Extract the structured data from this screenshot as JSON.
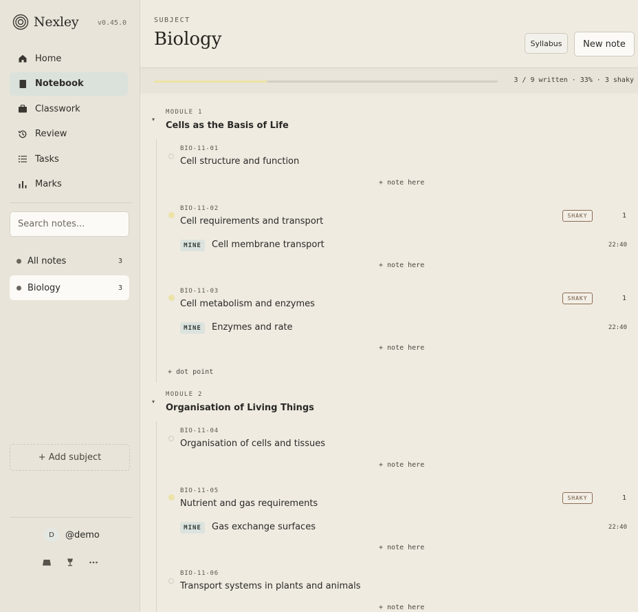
{
  "app": {
    "name": "Nexley",
    "version": "v0.45.0"
  },
  "nav": [
    {
      "label": "Home",
      "icon": "home-icon"
    },
    {
      "label": "Notebook",
      "icon": "notebook-icon",
      "active": true
    },
    {
      "label": "Classwork",
      "icon": "briefcase-icon"
    },
    {
      "label": "Review",
      "icon": "history-icon"
    },
    {
      "label": "Tasks",
      "icon": "list-icon"
    },
    {
      "label": "Marks",
      "icon": "bar-chart-icon"
    }
  ],
  "search": {
    "placeholder": "Search notes..."
  },
  "filters": [
    {
      "label": "All notes",
      "count": "3"
    },
    {
      "label": "Biology",
      "count": "3",
      "active": true
    }
  ],
  "add_subject_label": "+ Add subject",
  "user": {
    "initial": "D",
    "handle": "@demo"
  },
  "header": {
    "subject_label": "SUBJECT",
    "title": "Biology",
    "syllabus_label": "Syllabus",
    "new_note_label": "New note"
  },
  "progress": {
    "fraction": 0.33,
    "summary": "3 / 9 written · 33% · 3 shaky"
  },
  "shaky_label": "SHAKY",
  "mine_label": "MINE",
  "add_note_label": "+ note here",
  "add_dot_point_label": "+ dot point",
  "modules": [
    {
      "label": "MODULE 1",
      "title": "Cells as the Basis of Life",
      "dot_points": [
        {
          "code": "BIO-11-01",
          "title": "Cell structure and function"
        },
        {
          "code": "BIO-11-02",
          "title": "Cell requirements and transport",
          "count": "1",
          "note": {
            "title": "Cell membrane transport",
            "time": "22:40"
          }
        },
        {
          "code": "BIO-11-03",
          "title": "Cell metabolism and enzymes",
          "count": "1",
          "note": {
            "title": "Enzymes and rate",
            "time": "22:40"
          }
        }
      ]
    },
    {
      "label": "MODULE 2",
      "title": "Organisation of Living Things",
      "dot_points": [
        {
          "code": "BIO-11-04",
          "title": "Organisation of cells and tissues"
        },
        {
          "code": "BIO-11-05",
          "title": "Nutrient and gas requirements",
          "count": "1",
          "note": {
            "title": "Gas exchange surfaces",
            "time": "22:40"
          }
        },
        {
          "code": "BIO-11-06",
          "title": "Transport systems in plants and animals"
        }
      ]
    }
  ],
  "colors": {
    "accent_progress": "#ece3a6",
    "active_nav": "#dae2db",
    "shaky_border": "#8a6b52",
    "mine_tag": "#dce3df"
  }
}
